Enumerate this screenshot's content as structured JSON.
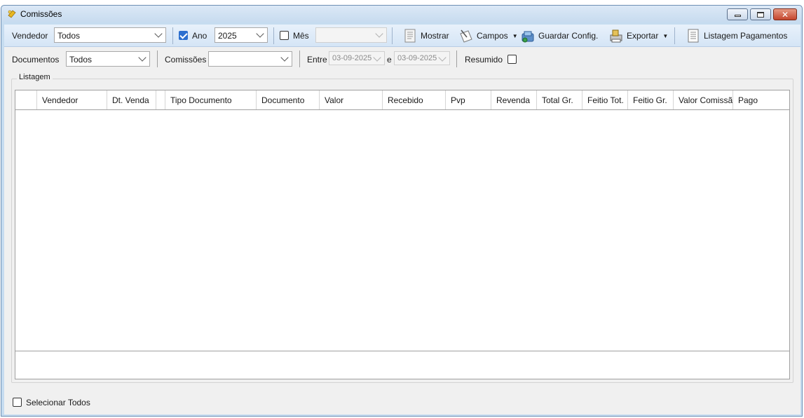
{
  "window": {
    "title": "Comissões"
  },
  "toolbar1": {
    "vendedor_label": "Vendedor",
    "vendedor_value": "Todos",
    "ano_checked": true,
    "ano_label": "Ano",
    "ano_value": "2025",
    "mes_checked": false,
    "mes_label": "Mês",
    "mes_value": "",
    "mostrar_label": "Mostrar",
    "campos_label": "Campos",
    "guardar_label": "Guardar Config.",
    "exportar_label": "Exportar",
    "listagem_pagamentos_label": "Listagem Pagamentos"
  },
  "toolbar2": {
    "documentos_label": "Documentos",
    "documentos_value": "Todos",
    "comissoes_label": "Comissões",
    "comissoes_value": "",
    "entre_label": "Entre",
    "date_from": "03-09-2025",
    "e_label": "e",
    "date_to": "03-09-2025",
    "resumido_label": "Resumido",
    "resumido_checked": false
  },
  "listagem": {
    "title": "Listagem",
    "columns": [
      "",
      "Vendedor",
      "Dt. Venda",
      "",
      "Tipo Documento",
      "Documento",
      "Valor",
      "Recebido",
      "Pvp",
      "Revenda",
      "Total Gr.",
      "Feitio Tot.",
      "Feitio Gr.",
      "Valor Comissão",
      "Pago"
    ],
    "rows": []
  },
  "footer": {
    "selecionar_todos_label": "Selecionar Todos",
    "selecionar_todos_checked": false
  }
}
